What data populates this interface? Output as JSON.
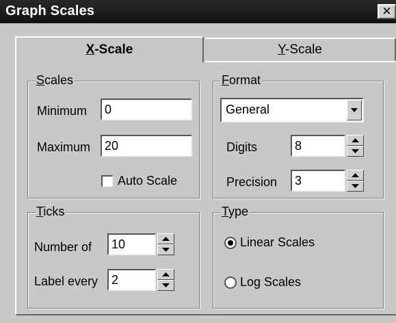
{
  "window": {
    "title": "Graph Scales",
    "close_glyph": "✕"
  },
  "tabs": [
    {
      "label": "X-Scale",
      "mnemonic": "X",
      "rest": "-Scale",
      "active": true
    },
    {
      "label": "Y-Scale",
      "mnemonic": "Y",
      "rest": "-Scale",
      "active": false
    }
  ],
  "scales": {
    "group_mnemonic": "S",
    "group_rest": "cales",
    "minimum_label": "Minimum",
    "minimum_value": "0",
    "maximum_label": "Maximum",
    "maximum_value": "20",
    "auto_scale_label": "Auto Scale",
    "auto_scale_checked": false
  },
  "format": {
    "group_mnemonic": "F",
    "group_rest": "ormat",
    "selected": "General",
    "digits_label": "Digits",
    "digits_value": "8",
    "precision_label": "Precision",
    "precision_value": "3"
  },
  "ticks": {
    "group_mnemonic": "T",
    "group_rest": "icks",
    "number_of_label": "Number of",
    "number_of_value": "10",
    "label_every_label": "Label every",
    "label_every_value": "2"
  },
  "type": {
    "group_mnemonic": "T",
    "group_rest": "ype",
    "options": [
      {
        "label": "Linear Scales",
        "selected": true
      },
      {
        "label": "Log Scales",
        "selected": false
      }
    ]
  },
  "icons": {
    "spin_up": "up-arrow-icon",
    "spin_down": "down-arrow-icon",
    "dropdown": "dropdown-arrow-icon"
  }
}
